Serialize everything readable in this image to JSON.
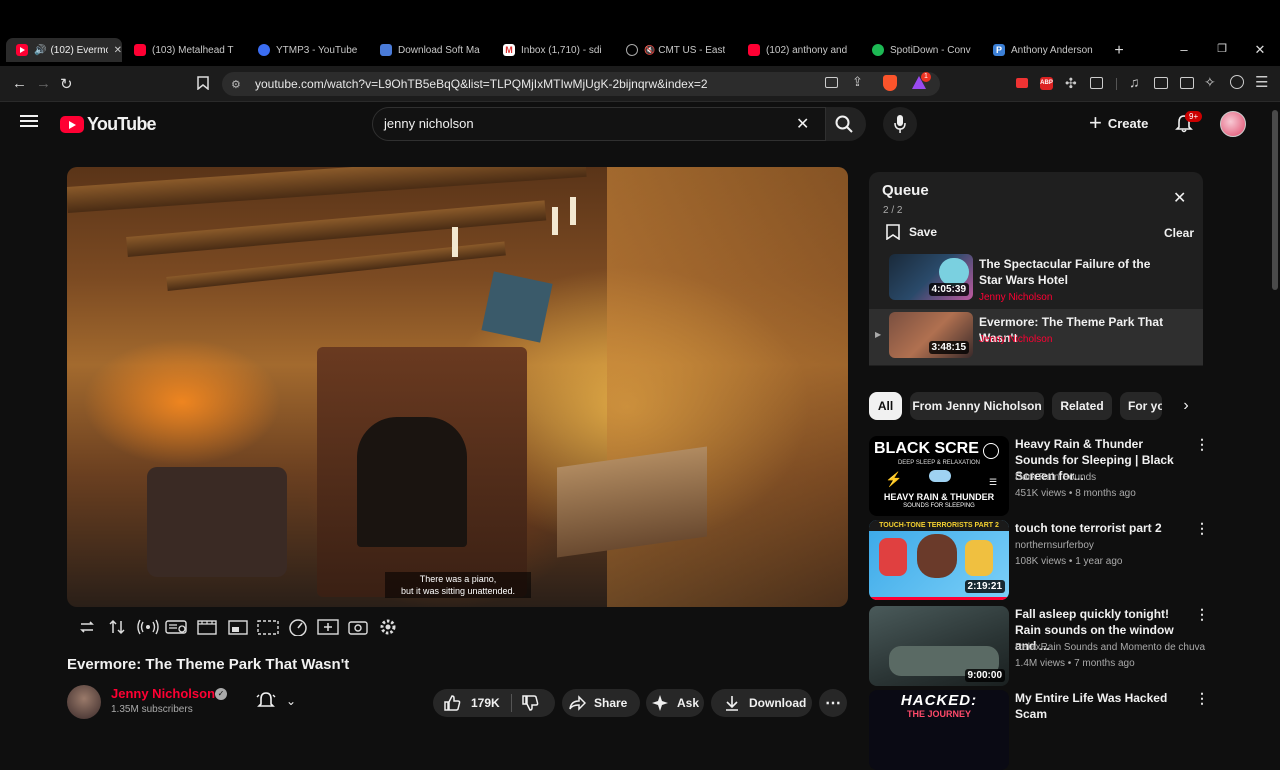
{
  "browser": {
    "tabs": [
      {
        "title": "(102) Evermore",
        "active": true,
        "fav": "youtube"
      },
      {
        "title": "(103) Metalhead T",
        "fav": "youtube"
      },
      {
        "title": "YTMP3 - YouTube",
        "fav": "ytmp3"
      },
      {
        "title": "Download Soft Ma",
        "fav": "mp3"
      },
      {
        "title": "Inbox (1,710) - sdi",
        "fav": "gmail"
      },
      {
        "title": "CMT US - East",
        "fav": "globe"
      },
      {
        "title": "(102) anthony and",
        "fav": "youtube"
      },
      {
        "title": "SpotiDown - Conv",
        "fav": "spotify"
      },
      {
        "title": "Anthony Anderson",
        "fav": "p"
      }
    ],
    "url": "youtube.com/watch?v=L9OhTB5eBqQ&list=TLPQMjIxMTIwMjUgK-2bijnqrw&index=2",
    "brave_badge": "1"
  },
  "header": {
    "logo_text": "YouTube",
    "search_value": "jenny nicholson",
    "create_label": "Create",
    "notif_badge": "9+"
  },
  "video": {
    "caption_line1": "There was a piano,",
    "caption_line2": "but it was sitting unattended.",
    "title": "Evermore: The Theme Park That Wasn't",
    "channel": "Jenny Nicholson",
    "subscribers": "1.35M subscribers",
    "likes": "179K",
    "share_label": "Share",
    "ask_label": "Ask",
    "download_label": "Download"
  },
  "queue": {
    "title": "Queue",
    "position": "2 / 2",
    "save_label": "Save",
    "clear_label": "Clear",
    "items": [
      {
        "title": "The Spectacular Failure of the Star Wars Hotel",
        "channel": "Jenny Nicholson",
        "duration": "4:05:39"
      },
      {
        "title": "Evermore: The Theme Park That Wasn't",
        "channel": "Jenny Nicholson",
        "duration": "3:48:15"
      }
    ]
  },
  "filters": [
    "All",
    "From Jenny Nicholson",
    "Related",
    "For yo"
  ],
  "recommendations": [
    {
      "title": "Heavy Rain & Thunder Sounds for Sleeping | Black Screen for...",
      "channel": "Dark Rain Sounds",
      "meta": "451K views • 8 months ago",
      "duration": "",
      "thumb_text1": "BLACK SCRE",
      "thumb_text2": "DEEP SLEEP & RELAXATION",
      "thumb_text3": "HEAVY RAIN & THUNDER",
      "thumb_text4": "SOUNDS FOR SLEEPING"
    },
    {
      "title": "touch tone terrorist part 2",
      "channel": "northernsurferboy",
      "meta": "108K views • 1 year ago",
      "duration": "2:19:21",
      "thumb_text1": "TOUCH-TONE TERRORISTS PART 2"
    },
    {
      "title": "Fall asleep quickly tonight! Rain sounds on the window and ...",
      "channel": "RelaxRain Sounds and Momento de chuva",
      "meta": "1.4M views • 7 months ago",
      "duration": "9:00:00"
    },
    {
      "title": "My Entire Life Was Hacked Scam",
      "channel": "",
      "meta": "",
      "duration": "",
      "thumb_text1": "HACKED:",
      "thumb_text2": "THE JOURNEY"
    }
  ],
  "colors": {
    "accent": "#ff0033",
    "bg": "#0f0f0f",
    "chip": "#272727"
  }
}
